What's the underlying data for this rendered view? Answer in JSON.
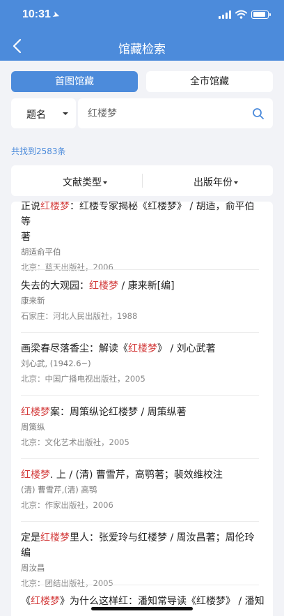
{
  "status_bar": {
    "time": "10:31",
    "battery_level": 0.85
  },
  "nav": {
    "title": "馆藏检索"
  },
  "segments": {
    "active": "首图馆藏",
    "inactive": "全市馆藏"
  },
  "search": {
    "field_type": "题名",
    "query": "红楼梦"
  },
  "result_count": "共找到2583条",
  "sort": {
    "type_label": "文献类型",
    "year_label": "出版年份"
  },
  "colors": {
    "accent": "#4c8bdb",
    "highlight": "#d33b3b"
  },
  "results": [
    {
      "title_parts": [
        {
          "text": "正说",
          "hl": false
        },
        {
          "text": "红楼梦",
          "hl": true
        },
        {
          "text": "：红楼专家揭秘《红楼梦》 / 胡适，俞平伯等",
          "hl": false
        }
      ],
      "title_line2": "著",
      "author": "胡适俞平伯",
      "publisher": "北京：蓝天出版社，2006"
    },
    {
      "title_parts": [
        {
          "text": "失去的大观园：",
          "hl": false
        },
        {
          "text": "红楼梦",
          "hl": true
        },
        {
          "text": " / 康来新[编]",
          "hl": false
        }
      ],
      "title_line2": "",
      "author": "康来新",
      "publisher": "石家庄：河北人民出版社，1988"
    },
    {
      "title_parts": [
        {
          "text": "画梁春尽落香尘：解读《",
          "hl": false
        },
        {
          "text": "红楼梦",
          "hl": true
        },
        {
          "text": "》 / 刘心武著",
          "hl": false
        }
      ],
      "title_line2": "",
      "author": "刘心武, (1942.6~)",
      "publisher": "北京：中国广播电视出版社，2005"
    },
    {
      "title_parts": [
        {
          "text": "红楼梦",
          "hl": true
        },
        {
          "text": "案：周策纵论红楼梦 / 周策纵著",
          "hl": false
        }
      ],
      "title_line2": "",
      "author": "周策纵",
      "publisher": "北京：文化艺术出版社，2005"
    },
    {
      "title_parts": [
        {
          "text": "红楼梦",
          "hl": true
        },
        {
          "text": ". 上 / (清) 曹雪芹，高鹗著；裴效维校注",
          "hl": false
        }
      ],
      "title_line2": "",
      "author": "(清) 曹雪芹,(清) 高鹗",
      "publisher": "北京：作家出版社，2006"
    },
    {
      "title_parts": [
        {
          "text": "定是",
          "hl": false
        },
        {
          "text": "红楼梦",
          "hl": true
        },
        {
          "text": "里人：张爱玲与红楼梦 / 周汝昌著；周伦玲编",
          "hl": false
        }
      ],
      "title_line2": "",
      "author": "周汝昌",
      "publisher": "北京：团结出版社，2005"
    },
    {
      "title_parts": [
        {
          "text": "《",
          "hl": false
        },
        {
          "text": "红楼梦",
          "hl": true
        },
        {
          "text": "》为什么这样红：潘知常导读《红楼梦》 / 潘知",
          "hl": false
        }
      ],
      "title_line2": "",
      "author": "",
      "publisher": ""
    }
  ]
}
